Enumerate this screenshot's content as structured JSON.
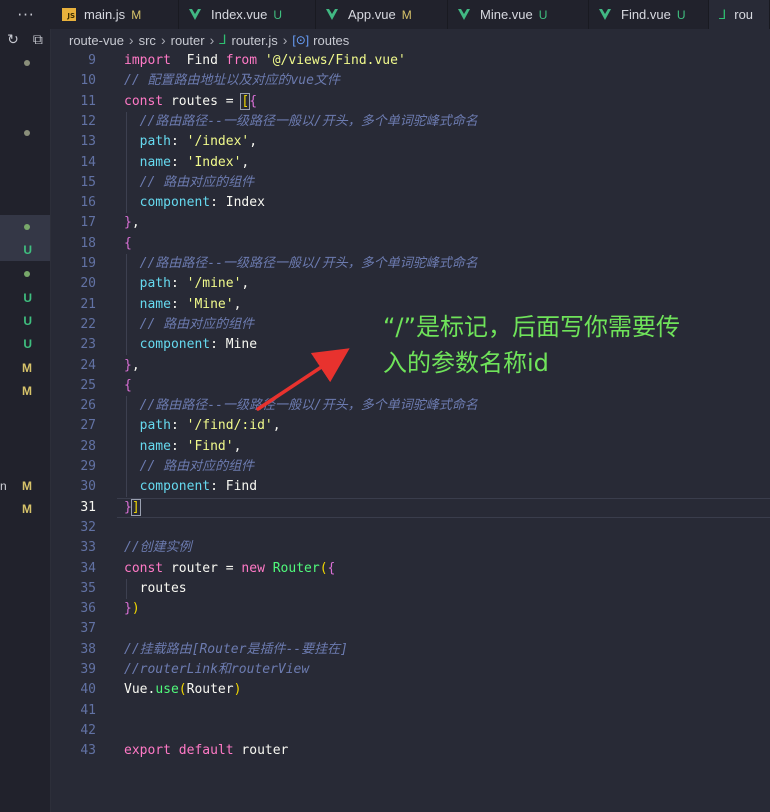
{
  "tabs": [
    {
      "label": "main.js",
      "status": "M",
      "icon": "js-icon"
    },
    {
      "label": "Index.vue",
      "status": "U",
      "icon": "vue-icon"
    },
    {
      "label": "App.vue",
      "status": "M",
      "icon": "vue-icon"
    },
    {
      "label": "Mine.vue",
      "status": "U",
      "icon": "vue-icon"
    },
    {
      "label": "Find.vue",
      "status": "U",
      "icon": "vue-icon"
    },
    {
      "label": "rou",
      "status": "",
      "icon": "router-icon"
    }
  ],
  "tab_overflow": "···",
  "breadcrumb": {
    "items": [
      "route-vue",
      "src",
      "router",
      "router.js",
      "routes"
    ]
  },
  "explorer_status": [
    {
      "mark": "",
      "color": "#8a8f7a",
      "dot": true
    },
    {
      "mark": "",
      "color": "#8a8f7a",
      "dot": true
    },
    {
      "mark": "",
      "color": "#78a86a",
      "dot": true
    },
    {
      "mark": "U",
      "color": "#3fbf7f",
      "dot": false
    },
    {
      "mark": "",
      "color": "#78a86a",
      "dot": true
    },
    {
      "mark": "U",
      "color": "#3fbf7f",
      "dot": false
    },
    {
      "mark": "U",
      "color": "#3fbf7f",
      "dot": false
    },
    {
      "mark": "U",
      "color": "#3fbf7f",
      "dot": false
    },
    {
      "mark": "M",
      "color": "#d7c36a",
      "dot": false
    },
    {
      "mark": "M",
      "color": "#d7c36a",
      "dot": false
    },
    {
      "mark": "M",
      "color": "#d7c36a",
      "dot": false,
      "prefix": "n"
    },
    {
      "mark": "M",
      "color": "#d7c36a",
      "dot": false
    }
  ],
  "editor": {
    "current_line": 31,
    "lines": [
      {
        "n": 9,
        "tokens": [
          [
            "kw",
            "import"
          ],
          [
            "",
            "  Find "
          ],
          [
            "kw",
            "from"
          ],
          [
            "",
            " "
          ],
          [
            "str",
            "'@/views/Find.vue'"
          ]
        ]
      },
      {
        "n": 10,
        "tokens": [
          [
            "cmt",
            "// 配置路由地址以及对应的vue文件"
          ]
        ]
      },
      {
        "n": 11,
        "tokens": [
          [
            "kw",
            "const"
          ],
          [
            "",
            " routes = "
          ],
          [
            "b1",
            "["
          ],
          [
            "b2",
            "{"
          ]
        ]
      },
      {
        "n": 12,
        "tokens": [
          [
            "",
            "  "
          ],
          [
            "cmt",
            "//路由路径--一级路径一般以/开头，多个单词驼峰式命名"
          ]
        ]
      },
      {
        "n": 13,
        "tokens": [
          [
            "",
            "  "
          ],
          [
            "prop",
            "path"
          ],
          [
            "",
            ": "
          ],
          [
            "str",
            "'/index'"
          ],
          [
            "",
            ","
          ]
        ]
      },
      {
        "n": 14,
        "tokens": [
          [
            "",
            "  "
          ],
          [
            "prop",
            "name"
          ],
          [
            "",
            ": "
          ],
          [
            "str",
            "'Index'"
          ],
          [
            "",
            ","
          ]
        ]
      },
      {
        "n": 15,
        "tokens": [
          [
            "",
            "  "
          ],
          [
            "cmt",
            "// 路由对应的组件"
          ]
        ]
      },
      {
        "n": 16,
        "tokens": [
          [
            "",
            "  "
          ],
          [
            "prop",
            "component"
          ],
          [
            "",
            ": Index"
          ]
        ]
      },
      {
        "n": 17,
        "tokens": [
          [
            "b2",
            "}"
          ],
          [
            "",
            ","
          ]
        ]
      },
      {
        "n": 18,
        "tokens": [
          [
            "b2",
            "{"
          ]
        ]
      },
      {
        "n": 19,
        "tokens": [
          [
            "",
            "  "
          ],
          [
            "cmt",
            "//路由路径--一级路径一般以/开头，多个单词驼峰式命名"
          ]
        ]
      },
      {
        "n": 20,
        "tokens": [
          [
            "",
            "  "
          ],
          [
            "prop",
            "path"
          ],
          [
            "",
            ": "
          ],
          [
            "str",
            "'/mine'"
          ],
          [
            "",
            ","
          ]
        ]
      },
      {
        "n": 21,
        "tokens": [
          [
            "",
            "  "
          ],
          [
            "prop",
            "name"
          ],
          [
            "",
            ": "
          ],
          [
            "str",
            "'Mine'"
          ],
          [
            "",
            ","
          ]
        ]
      },
      {
        "n": 22,
        "tokens": [
          [
            "",
            "  "
          ],
          [
            "cmt",
            "// 路由对应的组件"
          ]
        ]
      },
      {
        "n": 23,
        "tokens": [
          [
            "",
            "  "
          ],
          [
            "prop",
            "component"
          ],
          [
            "",
            ": Mine"
          ]
        ]
      },
      {
        "n": 24,
        "tokens": [
          [
            "b2",
            "}"
          ],
          [
            "",
            ","
          ]
        ]
      },
      {
        "n": 25,
        "tokens": [
          [
            "b2",
            "{"
          ]
        ]
      },
      {
        "n": 26,
        "tokens": [
          [
            "",
            "  "
          ],
          [
            "cmt",
            "//路由路径--一级路径一般以/开头，多个单词驼峰式命名"
          ]
        ]
      },
      {
        "n": 27,
        "tokens": [
          [
            "",
            "  "
          ],
          [
            "prop",
            "path"
          ],
          [
            "",
            ": "
          ],
          [
            "str",
            "'/find/:id'"
          ],
          [
            "",
            ","
          ]
        ]
      },
      {
        "n": 28,
        "tokens": [
          [
            "",
            "  "
          ],
          [
            "prop",
            "name"
          ],
          [
            "",
            ": "
          ],
          [
            "str",
            "'Find'"
          ],
          [
            "",
            ","
          ]
        ]
      },
      {
        "n": 29,
        "tokens": [
          [
            "",
            "  "
          ],
          [
            "cmt",
            "// 路由对应的组件"
          ]
        ]
      },
      {
        "n": 30,
        "tokens": [
          [
            "",
            "  "
          ],
          [
            "prop",
            "component"
          ],
          [
            "",
            ": Find"
          ]
        ]
      },
      {
        "n": 31,
        "tokens": [
          [
            "b2",
            "}"
          ],
          [
            "b1",
            "]"
          ]
        ]
      },
      {
        "n": 32,
        "tokens": []
      },
      {
        "n": 33,
        "tokens": [
          [
            "cmt",
            "//创建实例"
          ]
        ]
      },
      {
        "n": 34,
        "tokens": [
          [
            "kw",
            "const"
          ],
          [
            "",
            " router = "
          ],
          [
            "kw",
            "new"
          ],
          [
            "",
            " "
          ],
          [
            "fn",
            "Router"
          ],
          [
            "b1",
            "("
          ],
          [
            "b2",
            "{"
          ]
        ]
      },
      {
        "n": 35,
        "tokens": [
          [
            "",
            "  routes"
          ]
        ]
      },
      {
        "n": 36,
        "tokens": [
          [
            "b2",
            "}"
          ],
          [
            "b1",
            ")"
          ]
        ]
      },
      {
        "n": 37,
        "tokens": []
      },
      {
        "n": 38,
        "tokens": [
          [
            "cmt",
            "//挂载路由[Router是插件--要挂在]"
          ]
        ]
      },
      {
        "n": 39,
        "tokens": [
          [
            "cmt",
            "//routerLink和routerView"
          ]
        ]
      },
      {
        "n": 40,
        "tokens": [
          [
            "",
            "Vue."
          ],
          [
            "fn",
            "use"
          ],
          [
            "b1",
            "("
          ],
          [
            "",
            "Router"
          ],
          [
            "b1",
            ")"
          ]
        ]
      },
      {
        "n": 41,
        "tokens": []
      },
      {
        "n": 42,
        "tokens": []
      },
      {
        "n": 43,
        "tokens": [
          [
            "kw",
            "export"
          ],
          [
            "",
            " "
          ],
          [
            "kw",
            "default"
          ],
          [
            "",
            " router"
          ]
        ]
      }
    ]
  },
  "annotation": {
    "line1": "“/”是标记，后面写你需要传",
    "line2": "入的参数名称id",
    "color": "#6fe35a",
    "arrow_color": "#e8322e"
  }
}
